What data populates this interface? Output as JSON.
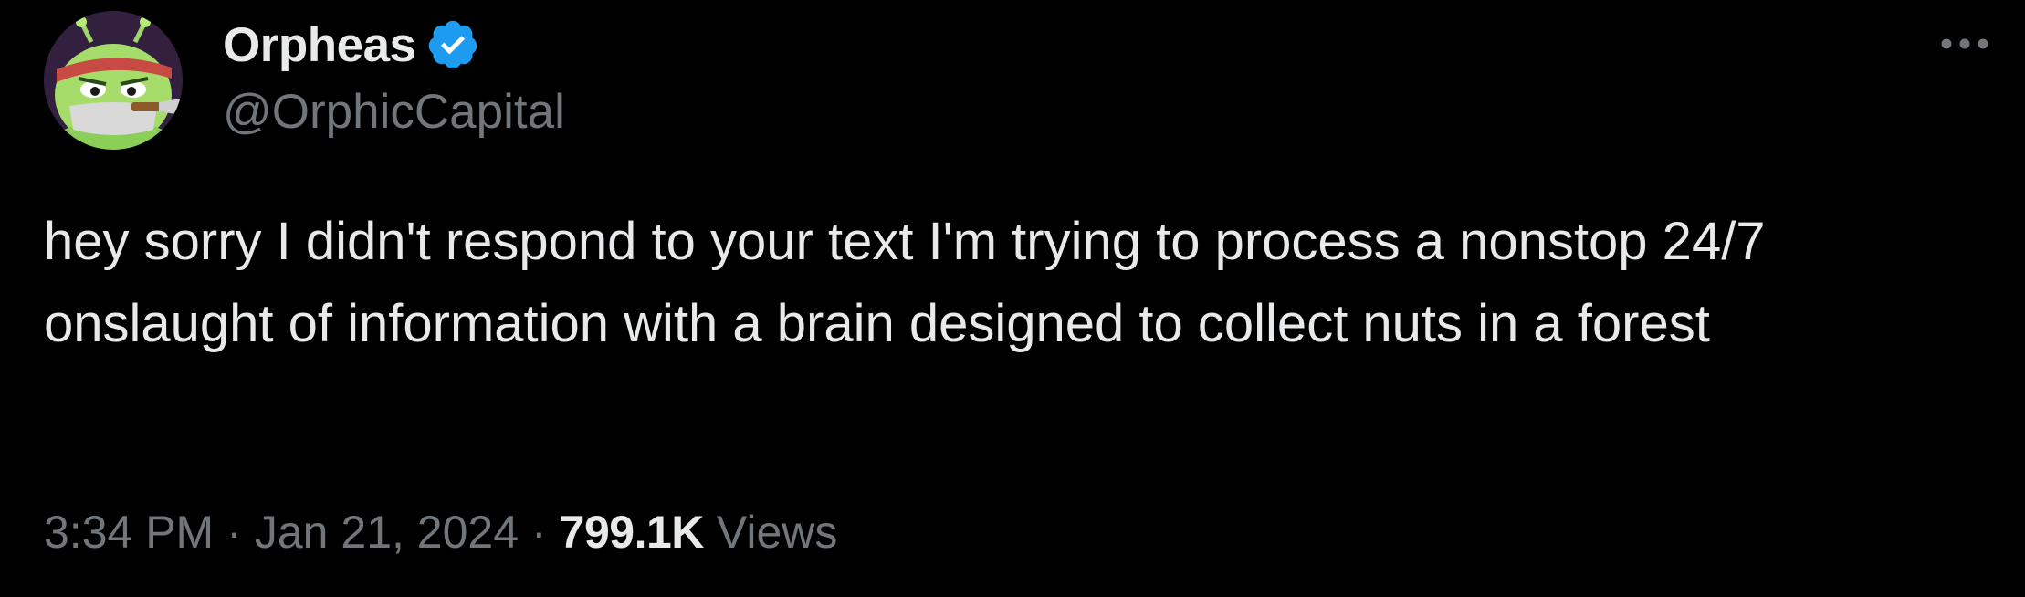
{
  "author": {
    "display_name": "Orpheas",
    "handle": "@OrphicCapital",
    "verified": true,
    "avatar": "green-alien-ninja-avatar"
  },
  "tweet": {
    "text": "hey sorry I didn't respond to your text I'm trying to process a nonstop 24/7 onslaught of information with a brain designed to collect nuts in a forest",
    "time": "3:34 PM",
    "separator": "·",
    "date": "Jan 21, 2024",
    "views_count": "799.1K",
    "views_label": "Views"
  },
  "icons": {
    "verified": "verified-badge-icon",
    "more": "more-options-icon"
  },
  "colors": {
    "background": "#000000",
    "primary_text": "#e7e9ea",
    "secondary_text": "#71767b",
    "verified_blue": "#1d9bf0"
  }
}
